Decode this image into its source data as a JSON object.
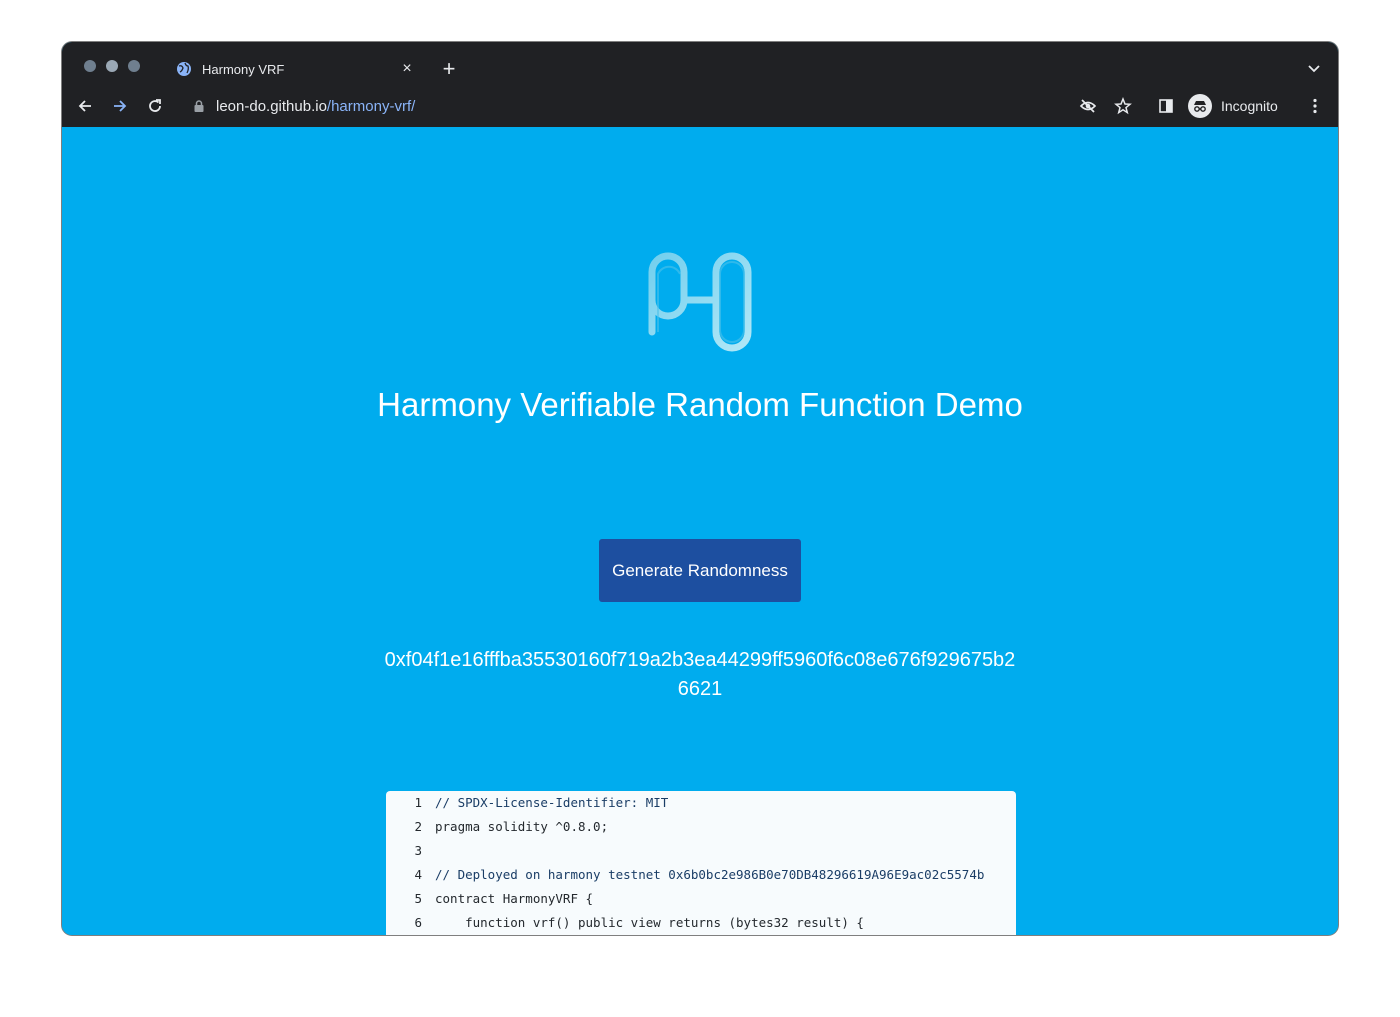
{
  "tab": {
    "title": "Harmony VRF",
    "close_glyph": "×",
    "new_tab_glyph": "+"
  },
  "address": {
    "host": "leon-do.github.io",
    "path": "/harmony-vrf/"
  },
  "profile": {
    "label": "Incognito"
  },
  "page": {
    "title": "Harmony Verifiable Random Function Demo",
    "button_label": "Generate Randomness",
    "result": "0xf04f1e16fffba35530160f719a2b3ea44299ff5960f6c08e676f929675b26621"
  },
  "code": {
    "lines": [
      {
        "n": "1",
        "text": "// SPDX-License-Identifier: MIT"
      },
      {
        "n": "2",
        "text": "pragma solidity ^0.8.0;"
      },
      {
        "n": "3",
        "text": ""
      },
      {
        "n": "4",
        "text": "// Deployed on harmony testnet 0x6b0bc2e986B0e70DB48296619A96E9ac02c5574b"
      },
      {
        "n": "5",
        "text": "contract HarmonyVRF {"
      },
      {
        "n": "6",
        "text": "    function vrf() public view returns (bytes32 result) {"
      }
    ]
  },
  "colors": {
    "page_background": "#00acee",
    "button_background": "#1d4fa0",
    "chrome_background": "#202124"
  }
}
